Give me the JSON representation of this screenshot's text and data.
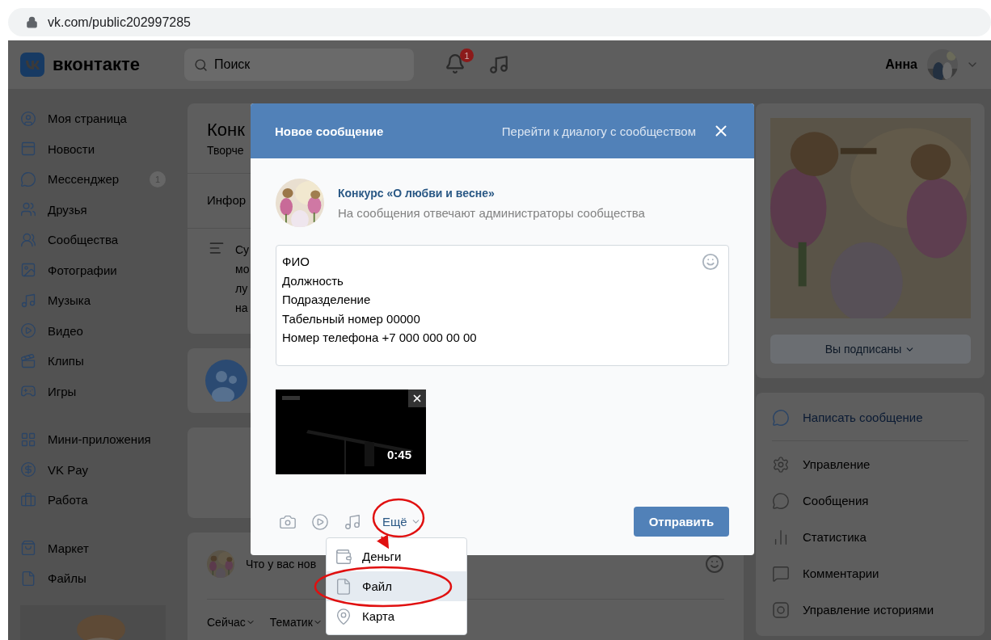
{
  "browser": {
    "url": "vk.com/public202997285"
  },
  "header": {
    "logo": "вконтакте",
    "search": {
      "placeholder": "Поиск"
    },
    "notification_count": "1",
    "user_name": "Анна"
  },
  "sidebar": {
    "groups": [
      [
        {
          "label": "Моя страница"
        },
        {
          "label": "Новости"
        },
        {
          "label": "Мессенджер",
          "badge": "1"
        },
        {
          "label": "Друзья"
        },
        {
          "label": "Сообщества"
        },
        {
          "label": "Фотографии"
        },
        {
          "label": "Музыка"
        },
        {
          "label": "Видео"
        },
        {
          "label": "Клипы"
        },
        {
          "label": "Игры"
        }
      ],
      [
        {
          "label": "Мини-приложения"
        },
        {
          "label": "VK Pay"
        },
        {
          "label": "Работа"
        }
      ],
      [
        {
          "label": "Маркет"
        },
        {
          "label": "Файлы"
        }
      ]
    ]
  },
  "community": {
    "title": "Конк",
    "subtitle": "Творче",
    "tab": "Инфор",
    "description": [
      "Су",
      "мо",
      "лу",
      "на"
    ],
    "post_placeholder": "Что у вас нов",
    "filters": [
      "Сейчас",
      "Тематик"
    ]
  },
  "right_panel": {
    "subscribe_button": "Вы подписаны",
    "primary_action": "Написать сообщение",
    "actions": [
      "Управление",
      "Сообщения",
      "Статистика",
      "Комментарии",
      "Управление историями"
    ]
  },
  "modal": {
    "title": "Новое сообщение",
    "dialog_link": "Перейти к диалогу с сообществом",
    "community_name": "Конкурс «О любви и весне»",
    "note": "На сообщения отвечают администраторы сообщества",
    "message_lines": [
      "ФИО",
      "Должность",
      "Подразделение",
      "Табельный номер 00000",
      "Номер телефона +7 000 000 00 00"
    ],
    "attachment": {
      "kind": "picture",
      "duration": "0:45"
    },
    "more_button": "Ещё",
    "send_button": "Отправить",
    "menu": [
      {
        "label": "Деньги",
        "selected": false
      },
      {
        "label": "Файл",
        "selected": true
      },
      {
        "label": "Карта",
        "selected": false
      }
    ]
  }
}
